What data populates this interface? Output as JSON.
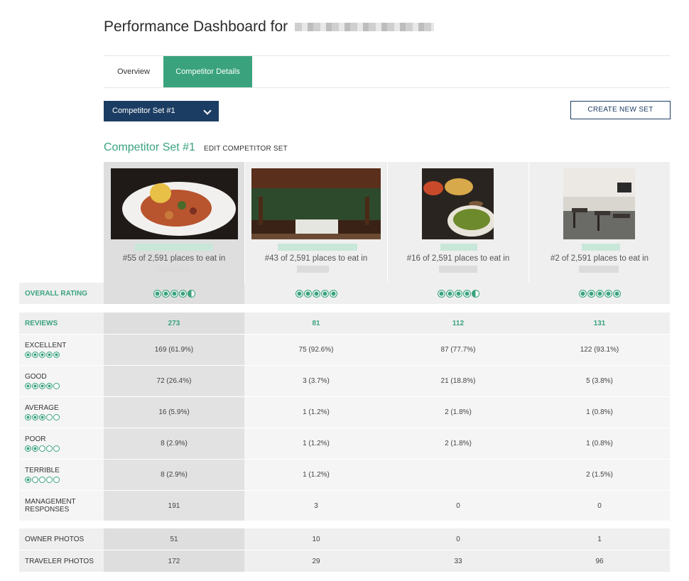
{
  "header": {
    "title": "Performance Dashboard for"
  },
  "tabs": [
    {
      "label": "Overview",
      "active": false
    },
    {
      "label": "Competitor Details",
      "active": true
    }
  ],
  "competitor_select": {
    "selected": "Competitor Set #1"
  },
  "create_button": {
    "label": "CREATE NEW SET"
  },
  "set": {
    "title": "Competitor Set #1",
    "edit_label": "EDIT COMPETITOR SET"
  },
  "competitors": [
    {
      "rank_text": "#55 of 2,591 places to eat in",
      "rating": 4.5,
      "reviews": "273",
      "excellent": "169 (61.9%)",
      "good": "72 (26.4%)",
      "average": "16 (5.9%)",
      "poor": "8 (2.9%)",
      "terrible": "8 (2.9%)",
      "management": "191",
      "owner_photos": "51",
      "traveler_photos": "172"
    },
    {
      "rank_text": "#43 of 2,591 places to eat in",
      "rating": 5,
      "reviews": "81",
      "excellent": "75 (92.6%)",
      "good": "3 (3.7%)",
      "average": "1 (1.2%)",
      "poor": "1 (1.2%)",
      "terrible": "1 (1.2%)",
      "management": "3",
      "owner_photos": "10",
      "traveler_photos": "29"
    },
    {
      "rank_text": "#16 of 2,591 places to eat in",
      "rating": 4.5,
      "reviews": "112",
      "excellent": "87 (77.7%)",
      "good": "21 (18.8%)",
      "average": "2 (1.8%)",
      "poor": "2 (1.8%)",
      "terrible": "",
      "management": "0",
      "owner_photos": "0",
      "traveler_photos": "33"
    },
    {
      "rank_text": "#2 of 2,591 places to eat in",
      "rating": 5,
      "reviews": "131",
      "excellent": "122 (93.1%)",
      "good": "5 (3.8%)",
      "average": "1 (0.8%)",
      "poor": "1 (0.8%)",
      "terrible": "2 (1.5%)",
      "management": "0",
      "owner_photos": "1",
      "traveler_photos": "96"
    }
  ],
  "row_labels": {
    "overall": "OVERALL RATING",
    "reviews": "REVIEWS",
    "excellent": "EXCELLENT",
    "good": "GOOD",
    "average": "AVERAGE",
    "poor": "POOR",
    "terrible": "TERRIBLE",
    "management": "MANAGEMENT RESPONSES",
    "owner_photos": "OWNER PHOTOS",
    "traveler_photos": "TRAVELER PHOTOS"
  },
  "colors": {
    "accent": "#3aa37d",
    "navy": "#1c3d63"
  }
}
